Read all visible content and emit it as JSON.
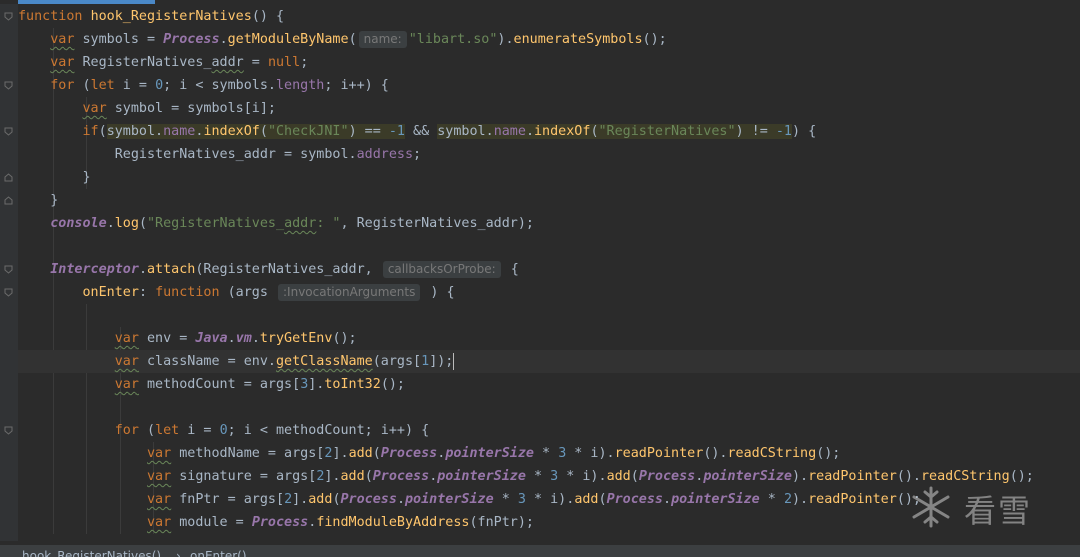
{
  "editor": {
    "accent": "#4a88c7",
    "background": "#2b2b2b",
    "lines": {
      "l1": {
        "kw": "function",
        "name": "hook_RegisterNatives",
        "rest": "() {"
      },
      "l2": {
        "kw": "var",
        "a": " symbols = ",
        "cls": "Process",
        "b": ".",
        "fn": "getModuleByName",
        "c": "(",
        "hint": "name:",
        "str": "\"libart.so\"",
        "d": ").",
        "fn2": "enumerateSymbols",
        "e": "();"
      },
      "l3": {
        "kw": "var",
        "a": " RegisterNatives_",
        "a2": "addr",
        "b": " = ",
        "kw2": "null",
        "c": ";"
      },
      "l4": {
        "kw": "for",
        "a": " (",
        "kw2": "let",
        "b": " i = ",
        "num": "0",
        "c": "; i < symbols.",
        "prop": "length",
        "d": "; i++) {"
      },
      "l5": {
        "kw": "var",
        "a": " symbol = symbols[i];"
      },
      "l6": {
        "kw": "if",
        "a": "(",
        "h1a": "symbol.",
        "h1p": "name",
        "h1b": ".",
        "h1f": "indexOf",
        "h1c": "(",
        "h1s": "\"CheckJNI\"",
        "h1d": ") == ",
        "h1n": "-1",
        "mid": " && ",
        "h2a": "symbol.",
        "h2p": "name",
        "h2b": ".",
        "h2f": "indexOf",
        "h2c": "(",
        "h2s": "\"RegisterNatives\"",
        "h2d": ") != ",
        "h2n": "-1",
        "z": ") {"
      },
      "l7": {
        "a": "RegisterNatives_addr = symbol.",
        "prop": "address",
        "b": ";"
      },
      "l8": {
        "a": "}"
      },
      "l9": {
        "a": "}"
      },
      "l10": {
        "gl": "console",
        "a": ".",
        "fn": "log",
        "b": "(",
        "str1": "\"RegisterNatives_",
        "str2": "addr",
        "str3": ": \"",
        "c": ", RegisterNatives_addr);"
      },
      "l12": {
        "gl": "Interceptor",
        "a": ".",
        "fn": "attach",
        "b": "(RegisterNatives_addr, ",
        "hint": "callbacksOrProbe:",
        "c": " {"
      },
      "l13": {
        "fn": "onEnter",
        "a": ": ",
        "kw": "function",
        "b": " (args ",
        "hint": ":InvocationArguments",
        "c": " ) {"
      },
      "l15": {
        "kw": "var",
        "a": " env = ",
        "gl": "Java",
        "b": ".",
        "gl2": "vm",
        "c": ".",
        "fn": "tryGetEnv",
        "d": "();"
      },
      "l16": {
        "kw": "var",
        "a": " className = env.",
        "fn": "getClassName",
        "b": "(args[",
        "num": "1",
        "c": "]);"
      },
      "l17": {
        "kw": "var",
        "a": " methodCount = args[",
        "num": "3",
        "b": "].",
        "fn": "toInt32",
        "c": "();"
      },
      "l19": {
        "kw": "for",
        "a": " (",
        "kw2": "let",
        "b": " i = ",
        "num": "0",
        "c": "; i < methodCount; i++) {"
      },
      "l20": {
        "kw": "var",
        "a": " methodName = args[",
        "n1": "2",
        "b": "].",
        "f1": "add",
        "c": "(",
        "gl": "Process",
        "d": ".",
        "gp": "pointerSize",
        "e": " * ",
        "n2": "3",
        "f": " * i).",
        "f2": "readPointer",
        "g": "().",
        "f3": "readCString",
        "h": "();"
      },
      "l21": {
        "kw": "var",
        "a": " signature = args[",
        "n1": "2",
        "b": "].",
        "f1": "add",
        "c": "(",
        "gl": "Process",
        "d": ".",
        "gp": "pointerSize",
        "e": " * ",
        "n2": "3",
        "f": " * i).",
        "f2": "add",
        "g": "(",
        "gl2": "Process",
        "h": ".",
        "gp2": "pointerSize",
        "i": ").",
        "f3": "readPointer",
        "j": "().",
        "f4": "readCString",
        "k": "();"
      },
      "l22": {
        "kw": "var",
        "a": " fnPtr = args[",
        "n1": "2",
        "b": "].",
        "f1": "add",
        "c": "(",
        "gl": "Process",
        "d": ".",
        "gp": "pointerSize",
        "e": " * ",
        "n2": "3",
        "f": " * i).",
        "f2": "add",
        "g": "(",
        "gl2": "Process",
        "h": ".",
        "gp2": "pointerSize",
        "i": " * ",
        "n3": "2",
        "j": ").",
        "f3": "readPointer",
        "k": "();"
      },
      "l23": {
        "kw": "var",
        "a": " module = ",
        "gl": "Process",
        "b": ".",
        "fn": "findModuleByAddress",
        "c": "(fnPtr);"
      }
    }
  },
  "breadcrumb": {
    "item1": "hook_RegisterNatives()",
    "sep": "›",
    "item2": "onEnter()"
  },
  "watermark": {
    "text": "看雪"
  }
}
